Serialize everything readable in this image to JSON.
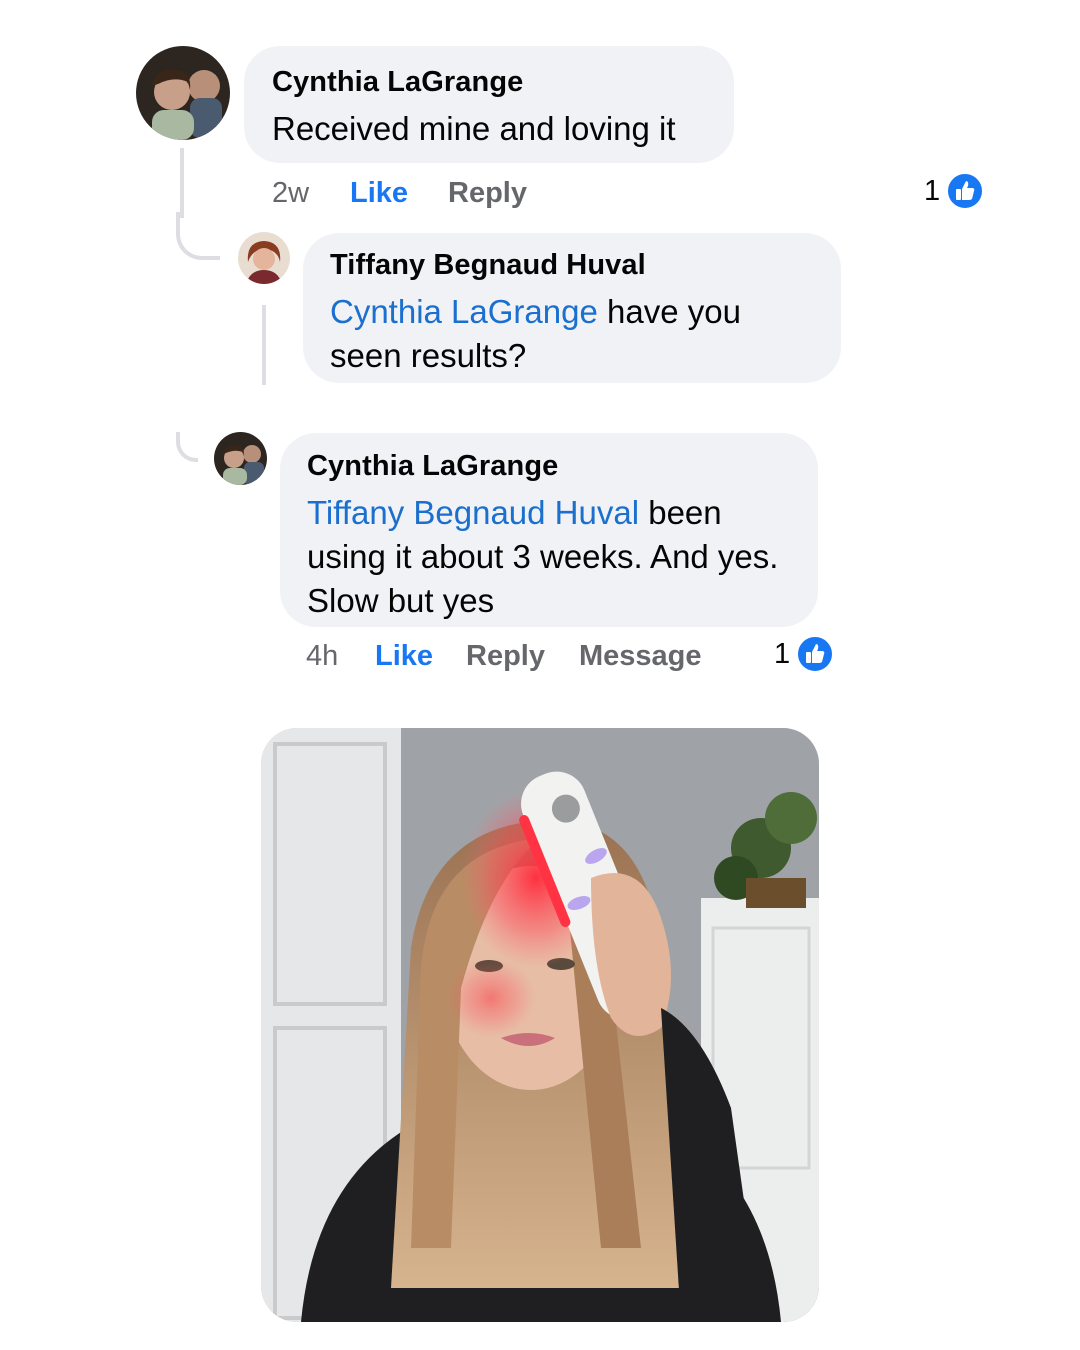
{
  "comments": [
    {
      "author": "Cynthia LaGrange",
      "text": "Received mine and loving it",
      "time": "2w",
      "like_label": "Like",
      "reply_label": "Reply",
      "reactions": "1"
    },
    {
      "author": "Tiffany Begnaud Huval",
      "mention": "Cynthia LaGrange",
      "text": " have you seen results?"
    },
    {
      "author": "Cynthia LaGrange",
      "mention": "Tiffany Begnaud Huval",
      "text": " been using it about 3 weeks.  And yes. Slow but yes",
      "time": "4h",
      "like_label": "Like",
      "reply_label": "Reply",
      "message_label": "Message",
      "reactions": "1"
    }
  ],
  "colors": {
    "bubble": "#f0f2f5",
    "mention": "#1a6fcf",
    "like_active": "#1877f2",
    "meta": "#65676b"
  },
  "icons": {
    "reaction": "thumbs-up-icon"
  }
}
